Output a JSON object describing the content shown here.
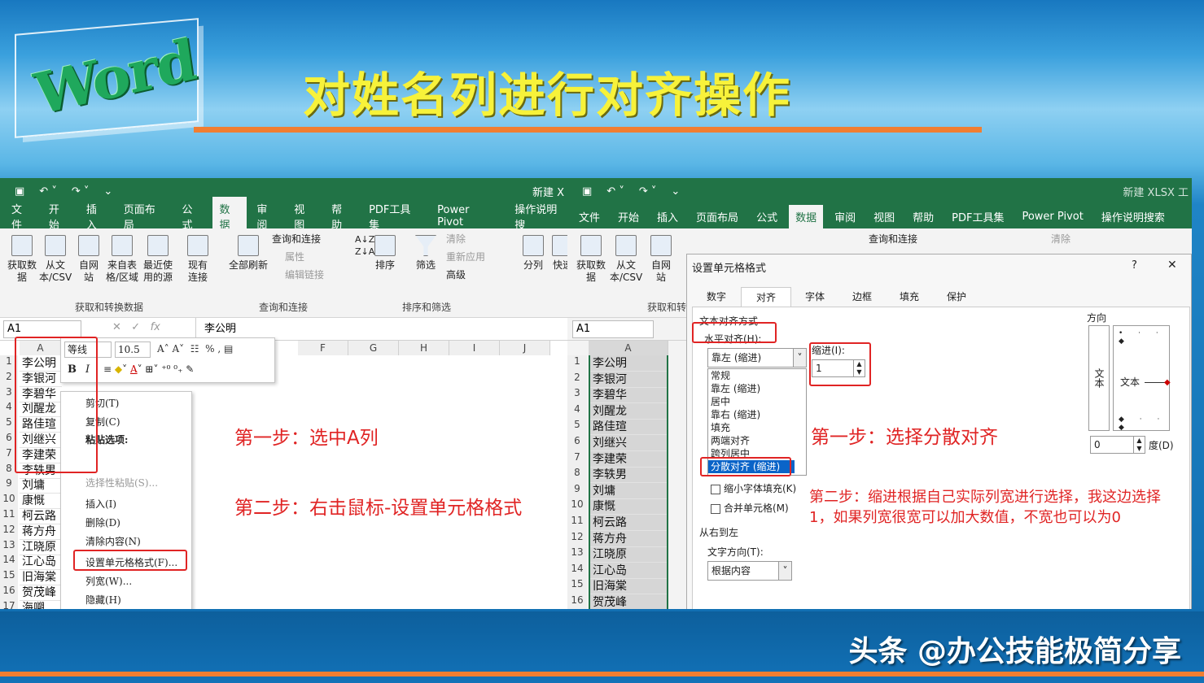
{
  "logo_text": "Word",
  "page_title": "对姓名列进行对齐操作",
  "watermark": "头条 @办公技能极简分享",
  "left": {
    "title_bar": "新建 X",
    "tabs": [
      "文件",
      "开始",
      "插入",
      "页面布局",
      "公式",
      "数据",
      "审阅",
      "视图",
      "帮助",
      "PDF工具集",
      "Power Pivot",
      "操作说明搜"
    ],
    "ribbon": {
      "get_data": "获取数据",
      "from_text": "从文本/CSV",
      "from_web": "自网站",
      "from_table": "来自表格/区域",
      "recent": "最近使用的源",
      "existing": "现有连接",
      "group1": "获取和转换数据",
      "refresh_all": "全部刷新",
      "queries": "查询和连接",
      "properties": "属性",
      "edit_links": "编辑链接",
      "group2": "查询和连接",
      "sort": "排序",
      "filter": "筛选",
      "clear": "清除",
      "reapply": "重新应用",
      "advanced": "高级",
      "group3": "排序和筛选",
      "split": "分列",
      "quick": "快速"
    },
    "name_box": "A1",
    "formula": "李公明",
    "mini_toolbar": {
      "font": "等线",
      "size": "10.5",
      "bold": "B",
      "italic": "I"
    },
    "col_headers": [
      "A",
      "F",
      "G",
      "H",
      "I",
      "J"
    ],
    "rows": [
      "李公明",
      "李银河",
      "李碧华",
      "刘醒龙",
      "路佳瑄",
      "刘继兴",
      "李建荣",
      "李轶男",
      "刘墉",
      "康慨",
      "柯云路",
      "蒋方舟",
      "江晓原",
      "江心岛",
      "旧海棠",
      "贺茂峰",
      "海嗍"
    ],
    "context_menu": [
      "剪切(T)",
      "复制(C)",
      "粘贴选项:",
      "选择性粘贴(S)...",
      "插入(I)",
      "删除(D)",
      "清除内容(N)",
      "设置单元格格式(F)...",
      "列宽(W)...",
      "隐藏(H)"
    ],
    "step1": "第一步：选中A列",
    "step2": "第二步：右击鼠标-设置单元格格式"
  },
  "right": {
    "title_bar": "新建 XLSX 工",
    "tabs": [
      "文件",
      "开始",
      "插入",
      "页面布局",
      "公式",
      "数据",
      "审阅",
      "视图",
      "帮助",
      "PDF工具集",
      "Power Pivot",
      "操作说明搜索"
    ],
    "ribbon": {
      "get_data": "获取数据",
      "from_text": "从文本/CSV",
      "from_web": "自网站",
      "queries": "查询和连接",
      "clear": "清除",
      "group1": "获取和转换"
    },
    "name_box": "A1",
    "col_header": "A",
    "rows": [
      "李公明",
      "李银河",
      "李碧华",
      "刘醒龙",
      "路佳瑄",
      "刘继兴",
      "李建荣",
      "李轶男",
      "刘墉",
      "康慨",
      "柯云路",
      "蒋方舟",
      "江晓原",
      "江心岛",
      "旧海棠",
      "贺茂峰"
    ],
    "dialog": {
      "title": "设置单元格格式",
      "help": "?",
      "close": "✕",
      "tabs": [
        "数字",
        "对齐",
        "字体",
        "边框",
        "填充",
        "保护"
      ],
      "section_align": "文本对齐方式",
      "h_align_label": "水平对齐(H):",
      "h_align_value": "靠左 (缩进)",
      "h_options": [
        "常规",
        "靠左 (缩进)",
        "居中",
        "靠右 (缩进)",
        "填充",
        "两端对齐",
        "跨列居中",
        "分散对齐 (缩进)"
      ],
      "indent_label": "缩进(I):",
      "indent_value": "1",
      "v_label_partial": "文",
      "shrink": "缩小字体填充(K)",
      "merge": "合并单元格(M)",
      "rtl": "从右到左",
      "text_dir_label": "文字方向(T):",
      "text_dir_value": "根据内容",
      "orientation": "方向",
      "vert_text": "文本",
      "orient_text": "文本",
      "degree_value": "0",
      "degree_label": "度(D)"
    },
    "step1": "第一步：选择分散对齐",
    "step2": "第二步：缩进根据自己实际列宽进行选择，我这边选择1，如果列宽很宽可以加大数值，不宽也可以为0"
  }
}
